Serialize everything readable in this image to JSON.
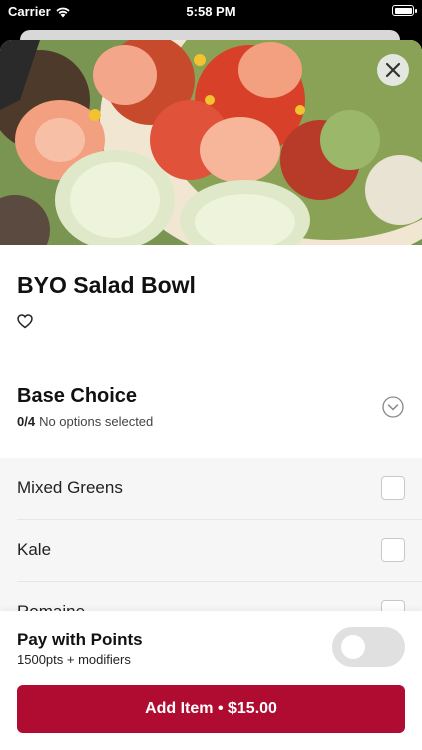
{
  "status_bar": {
    "carrier": "Carrier",
    "time": "5:58 PM"
  },
  "icons": {
    "wifi": "wifi-icon",
    "battery": "battery-icon",
    "close": "close-icon",
    "favorite": "heart-icon",
    "expand": "chevron-down-circle-icon"
  },
  "item": {
    "title": "BYO Salad Bowl"
  },
  "section": {
    "title": "Base Choice",
    "count": "0/4",
    "status": "No options selected"
  },
  "options": [
    {
      "label": "Mixed Greens",
      "checked": false
    },
    {
      "label": "Kale",
      "checked": false
    },
    {
      "label": "Romaine",
      "checked": false
    }
  ],
  "points": {
    "title": "Pay with Points",
    "subtitle": "1500pts + modifiers",
    "enabled": false
  },
  "cta": {
    "label": "Add Item • $15.00"
  },
  "colors": {
    "brand": "#b00b30",
    "toggle_off": "#e0e0e0"
  }
}
